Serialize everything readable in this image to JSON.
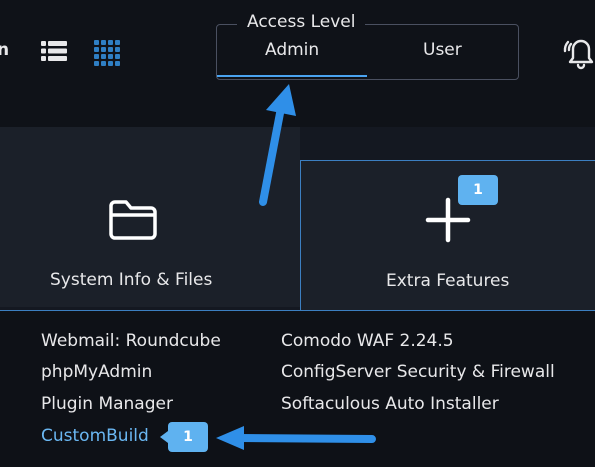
{
  "header": {
    "nav_partial": "n",
    "access_level": {
      "legend": "Access Level",
      "tabs": [
        {
          "label": "Admin",
          "active": true
        },
        {
          "label": "User",
          "active": false
        }
      ]
    }
  },
  "cards": [
    {
      "label": "System Info & Files",
      "icon": "folder-icon"
    },
    {
      "label": "Extra Features",
      "icon": "plus-icon",
      "badge": "1"
    }
  ],
  "menu": {
    "left": [
      "Webmail: Roundcube",
      "phpMyAdmin",
      "Plugin Manager",
      "CustomBuild"
    ],
    "right": [
      "Comodo WAF 2.24.5",
      "ConfigServer Security & Firewall",
      "Softaculous Auto Installer"
    ],
    "custombuild_badge": "1"
  },
  "colors": {
    "accent": "#4aa3f0",
    "badge": "#5fb2f0",
    "background": "#141821"
  }
}
